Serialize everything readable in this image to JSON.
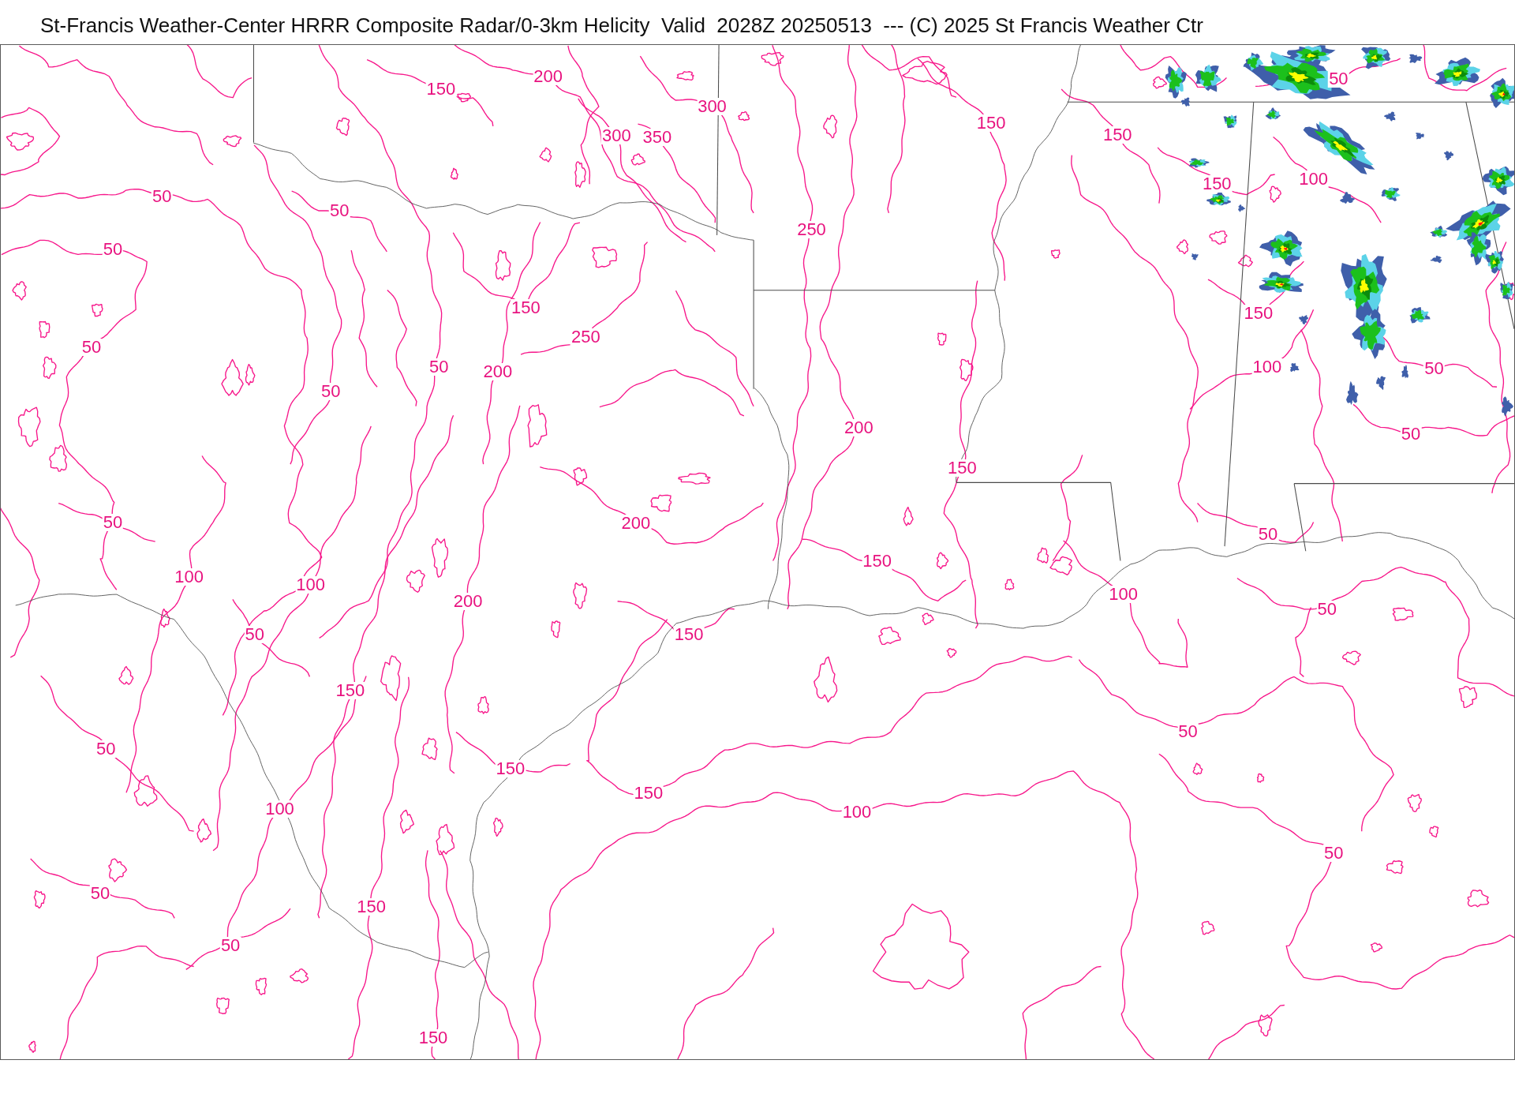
{
  "title": "St-Francis Weather-Center HRRR Composite Radar/0-3km Helicity  Valid  2028Z 20250513  --- (C) 2025 St Francis Weather Ctr",
  "map": {
    "contour_labels": [
      "200",
      "50",
      "150",
      "300",
      "150",
      "300",
      "350",
      "150",
      "150",
      "100",
      "50",
      "50",
      "250",
      "50",
      "150",
      "150",
      "50",
      "250",
      "50",
      "200",
      "100",
      "50",
      "50",
      "200",
      "50",
      "150",
      "50",
      "200",
      "50",
      "150",
      "100",
      "100",
      "200",
      "100",
      "50",
      "50",
      "150",
      "150",
      "50",
      "50",
      "150",
      "150",
      "100",
      "100",
      "50",
      "50",
      "150",
      "50",
      "150"
    ]
  }
}
